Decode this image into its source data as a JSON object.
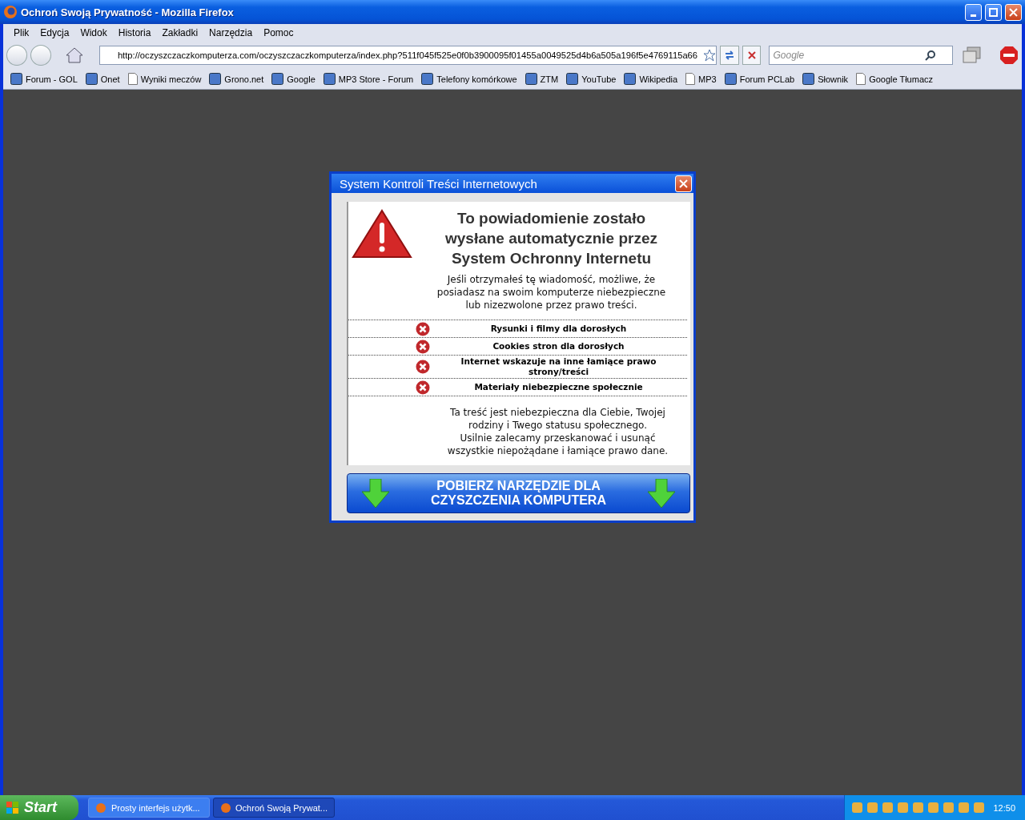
{
  "window": {
    "title": "Ochroń Swoją Prywatność - Mozilla Firefox"
  },
  "menu": [
    "Plik",
    "Edycja",
    "Widok",
    "Historia",
    "Zakładki",
    "Narzędzia",
    "Pomoc"
  ],
  "address": {
    "url": "http://oczyszczaczkomputerza.com/oczyszczaczkomputerza/index.php?511f045f525e0f0b3900095f01455a0049525d4b6a505a196f5e4769115a66"
  },
  "search": {
    "placeholder": "Google"
  },
  "bookmarks": [
    {
      "label": "Forum - GOL",
      "kind": "site"
    },
    {
      "label": "Onet",
      "kind": "site"
    },
    {
      "label": "Wyniki meczów",
      "kind": "page"
    },
    {
      "label": "Grono.net",
      "kind": "site"
    },
    {
      "label": "Google",
      "kind": "site"
    },
    {
      "label": "MP3 Store - Forum",
      "kind": "site"
    },
    {
      "label": "Telefony komórkowe",
      "kind": "site"
    },
    {
      "label": "ZTM",
      "kind": "site"
    },
    {
      "label": "YouTube",
      "kind": "site"
    },
    {
      "label": "Wikipedia",
      "kind": "site"
    },
    {
      "label": "MP3",
      "kind": "page"
    },
    {
      "label": "Forum PCLab",
      "kind": "site"
    },
    {
      "label": "Słownik",
      "kind": "site"
    },
    {
      "label": "Google Tłumacz",
      "kind": "page"
    }
  ],
  "dialog": {
    "title": "System Kontroli Treści Internetowych",
    "heading": [
      "To powiadomienie zostało",
      "wysłane automatycznie przez",
      "System Ochronny Internetu"
    ],
    "intro": [
      "Jeśli otrzymałeś tę wiadomość, możliwe, że",
      "posiadasz na swoim komputerze niebezpieczne",
      "lub nizezwolone przez prawo treści."
    ],
    "threats": [
      [
        "Rysunki i filmy dla dorosłych"
      ],
      [
        "Cookies stron dla dorosłych"
      ],
      [
        "Internet wskazuje na inne łamiące prawo",
        "strony/treści"
      ],
      [
        "Materiały niebezpieczne społecznie"
      ]
    ],
    "footer": [
      "Ta treść jest niebezpieczna dla Ciebie, Twojej",
      "rodziny i Twego statusu społecznego.",
      "Usilnie zalecamy przeskanować i usunąć",
      "wszystkie niepożądane i łamiące prawo dane."
    ],
    "download_button": [
      "POBIERZ NARZĘDZIE DLA",
      "CZYSZCZENIA KOMPUTERA"
    ]
  },
  "taskbar": {
    "start": "Start",
    "tasks": [
      {
        "label": "Prosty interfejs użytk...",
        "selected": false
      },
      {
        "label": "Ochroń Swoją Prywat...",
        "selected": true
      }
    ],
    "clock": "12:50"
  }
}
